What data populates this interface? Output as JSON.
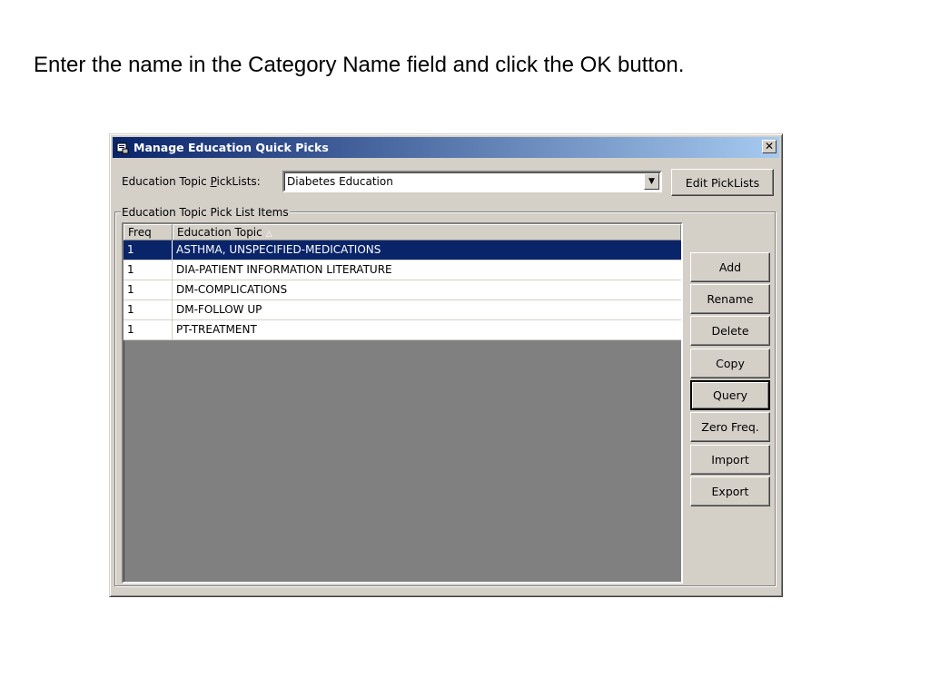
{
  "instruction": "Enter the name in the Category Name field and click the OK button.",
  "window": {
    "title": "Manage Education Quick Picks",
    "close_glyph": "✕"
  },
  "picklist": {
    "label_prefix": "Education Topic ",
    "label_accel": "P",
    "label_suffix": "ickLists:",
    "selected_value": "Diabetes Education",
    "edit_button": "Edit PickLists"
  },
  "items_group": {
    "legend": "Education Topic Pick List Items",
    "columns": [
      "Freq",
      "Education Topic"
    ],
    "sort_indicator": "△",
    "rows": [
      {
        "freq": "1",
        "topic": "ASTHMA, UNSPECIFIED-MEDICATIONS",
        "selected": true
      },
      {
        "freq": "1",
        "topic": "DIA-PATIENT INFORMATION LITERATURE",
        "selected": false
      },
      {
        "freq": "1",
        "topic": "DM-COMPLICATIONS",
        "selected": false
      },
      {
        "freq": "1",
        "topic": "DM-FOLLOW UP",
        "selected": false
      },
      {
        "freq": "1",
        "topic": "PT-TREATMENT",
        "selected": false
      }
    ]
  },
  "actions": {
    "add": "Add",
    "rename": "Rename",
    "delete": "Delete",
    "copy": "Copy",
    "query": "Query",
    "zero_freq": "Zero Freq.",
    "import": "Import",
    "export": "Export"
  },
  "colors": {
    "selection": "#0a246a",
    "face": "#d4d0c8",
    "list_empty": "#808080"
  }
}
